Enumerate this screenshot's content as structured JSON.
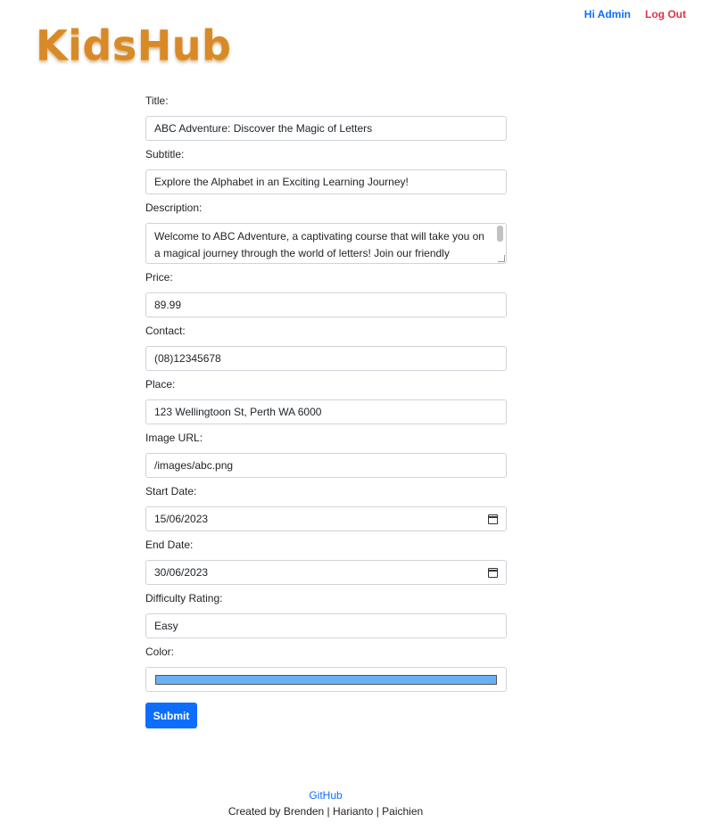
{
  "brand": {
    "logo_text": "KidsHub"
  },
  "nav": {
    "greeting": "Hi Admin",
    "logout": "Log Out"
  },
  "form": {
    "fields": {
      "title": {
        "label": "Title:",
        "value": "ABC Adventure: Discover the Magic of Letters"
      },
      "subtitle": {
        "label": "Subtitle:",
        "value": "Explore the Alphabet in an Exciting Learning Journey!"
      },
      "description": {
        "label": "Description:",
        "value": "Welcome to ABC Adventure, a captivating course that will take you on a magical journey through the world of letters! Join our friendly"
      },
      "price": {
        "label": "Price:",
        "value": "89.99"
      },
      "contact": {
        "label": "Contact:",
        "value": "(08)12345678"
      },
      "place": {
        "label": "Place:",
        "value": "123 Wellingtoon St, Perth WA 6000"
      },
      "image_url": {
        "label": "Image URL:",
        "value": "/images/abc.png"
      },
      "start_date": {
        "label": "Start Date:",
        "value": "15/06/2023"
      },
      "end_date": {
        "label": "End Date:",
        "value": "30/06/2023"
      },
      "difficulty": {
        "label": "Difficulty Rating:",
        "value": "Easy"
      },
      "color": {
        "label": "Color:",
        "value": "#6bb0f5"
      }
    },
    "submit_label": "Submit"
  },
  "footer": {
    "github": "GitHub",
    "credits": "Created by Brenden | Harianto | Paichien"
  },
  "colors": {
    "primary": "#0d6efd",
    "danger": "#dc3545",
    "logo": "#d88a28"
  }
}
